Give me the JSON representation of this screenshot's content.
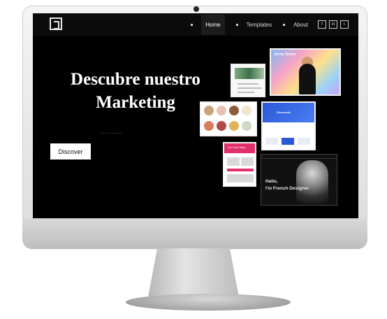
{
  "nav": {
    "items": [
      {
        "label": "Home",
        "active": true
      },
      {
        "label": "Templates",
        "active": false
      },
      {
        "label": "About",
        "active": false
      }
    ],
    "social": [
      "f",
      "in",
      "t"
    ]
  },
  "hero": {
    "title_line1": "Descubre nuestro",
    "title_line2": "Marketing",
    "cta_label": "Discover"
  },
  "thumbnails": {
    "hero_name": "Jenny Torres",
    "blue_title": "Showcode",
    "pink_name": "Lee Clark Valley",
    "dark_hello_line1": "Hello,",
    "dark_hello_line2": "I'm French Designer"
  },
  "colors": {
    "screen_bg": "#000000",
    "nav_bg": "#0b0b0b",
    "cta_bg": "#ffffff",
    "accent_pink": "#e1306c",
    "accent_blue": "#2b58d8"
  }
}
